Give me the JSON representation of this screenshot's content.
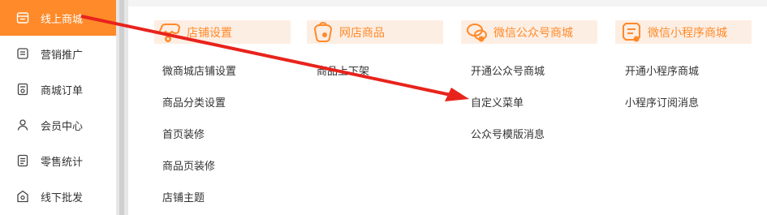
{
  "sidebar": {
    "items": [
      {
        "label": "线上商城",
        "icon": "store-icon",
        "active": true
      },
      {
        "label": "营销推广",
        "icon": "marketing-icon",
        "active": false
      },
      {
        "label": "商城订单",
        "icon": "order-icon",
        "active": false
      },
      {
        "label": "会员中心",
        "icon": "member-icon",
        "active": false
      },
      {
        "label": "零售统计",
        "icon": "statistics-icon",
        "active": false
      },
      {
        "label": "线下批发",
        "icon": "wholesale-icon",
        "active": false
      }
    ]
  },
  "columns": [
    {
      "title": "店铺设置",
      "icon": "shop-settings-icon",
      "links": [
        "微商城店铺设置",
        "商品分类设置",
        "首页装修",
        "商品页装修",
        "店铺主题"
      ]
    },
    {
      "title": "网店商品",
      "icon": "product-tag-icon",
      "links": [
        "商品上下架"
      ]
    },
    {
      "title": "微信公众号商城",
      "icon": "wechat-official-icon",
      "links": [
        "开通公众号商城",
        "自定义菜单",
        "公众号模版消息"
      ]
    },
    {
      "title": "微信小程序商城",
      "icon": "mini-program-icon",
      "links": [
        "开通小程序商城",
        "小程序订阅消息"
      ]
    }
  ],
  "colors": {
    "accent": "#ff8a2a",
    "header_bg": "#fdeee3",
    "annotation_arrow": "#e8231c"
  }
}
